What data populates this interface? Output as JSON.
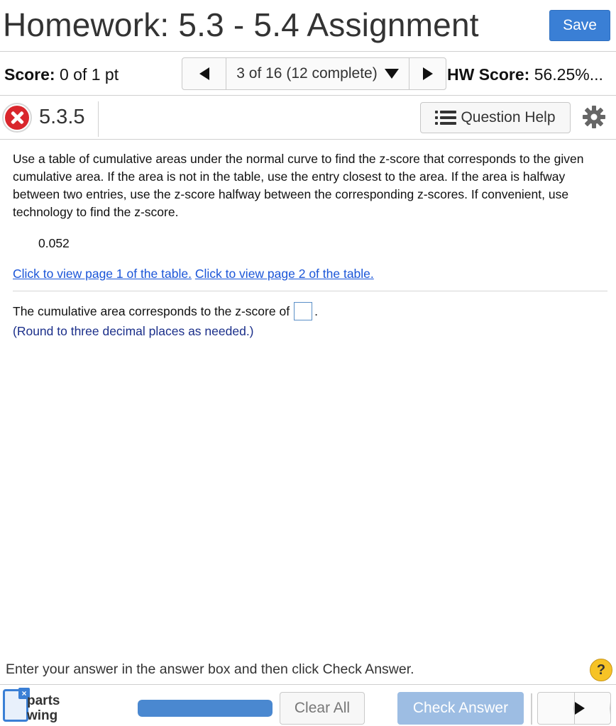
{
  "header": {
    "title": "Homework: 5.3 - 5.4 Assignment",
    "save_label": "Save"
  },
  "scorebar": {
    "score_label": "Score:",
    "score_value": "0 of 1 pt",
    "nav_position": "3 of 16 (12 complete)",
    "hw_score_label": "HW Score:",
    "hw_score_value": "56.25%..."
  },
  "question": {
    "status": "incorrect",
    "number": "5.3.5",
    "help_label": "Question Help",
    "instructions": "Use a table of cumulative areas under the normal curve to find the z-score that corresponds to the given cumulative area. If the area is not in the table, use the entry closest to the area. If the area is halfway between two entries, use the z-score halfway between the corresponding z-scores. If convenient, use technology to find the z-score.",
    "given_area": "0.052",
    "link_page1": "Click to view page 1 of the table.",
    "link_page2": "Click to view page 2 of the table.",
    "answer_prefix": "The cumulative area corresponds to the z-score of",
    "answer_suffix": ".",
    "answer_value": "",
    "round_note": "(Round to three decimal places as needed.)"
  },
  "footer": {
    "instruction": "Enter your answer in the answer box and then click Check Answer.",
    "help_symbol": "?",
    "parts_line1": "parts",
    "parts_line2": "wing",
    "parts_badge": "×",
    "progress_fraction": 1.0,
    "clear_label": "Clear All",
    "check_label": "Check Answer"
  },
  "colors": {
    "accent": "#3a7fd5",
    "link": "#1a55d8",
    "incorrect": "#d9262c",
    "check_disabled": "#9dbde3",
    "help_yellow": "#f6c326"
  },
  "icons": [
    "close-icon",
    "list-icon",
    "gear-icon",
    "help-icon",
    "parts-icon",
    "caret-left-icon",
    "caret-right-icon",
    "caret-down-icon"
  ]
}
